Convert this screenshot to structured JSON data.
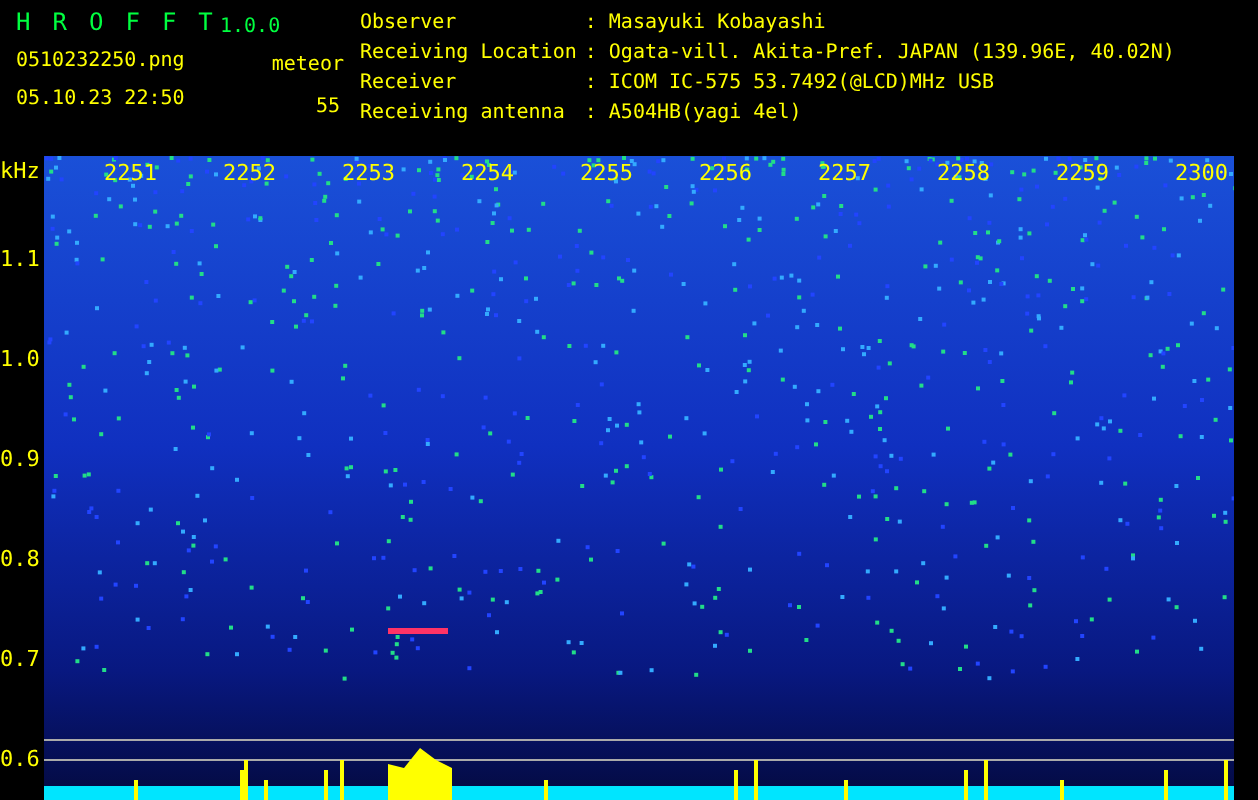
{
  "app": {
    "title_letters": [
      "H",
      "R",
      "O",
      "F",
      "F",
      "T"
    ],
    "version": "1.0.0",
    "filename": "0510232250.png",
    "datetime": "05.10.23 22:50"
  },
  "counter": {
    "label": "meteor",
    "value": "55"
  },
  "info": [
    {
      "label": "Observer",
      "separator": ":",
      "value": "Masayuki Kobayashi"
    },
    {
      "label": "Receiving Location",
      "separator": ":",
      "value": "Ogata-vill. Akita-Pref. JAPAN (139.96E, 40.02N)"
    },
    {
      "label": "Receiver",
      "separator": ":",
      "value": "ICOM IC-575 53.7492(@LCD)MHz USB"
    },
    {
      "label": "Receiving antenna",
      "separator": ":",
      "value": "A504HB(yagi 4el)"
    }
  ],
  "spectrogram": {
    "y_unit": "kHz",
    "y_ticks": [
      "1.1",
      "1.0",
      "0.9",
      "0.8",
      "0.7",
      "0.6"
    ],
    "time_labels": [
      "2251",
      "2252",
      "2253",
      "2254",
      "2255",
      "2256",
      "2257",
      "2258",
      "2259",
      "2300"
    ]
  }
}
